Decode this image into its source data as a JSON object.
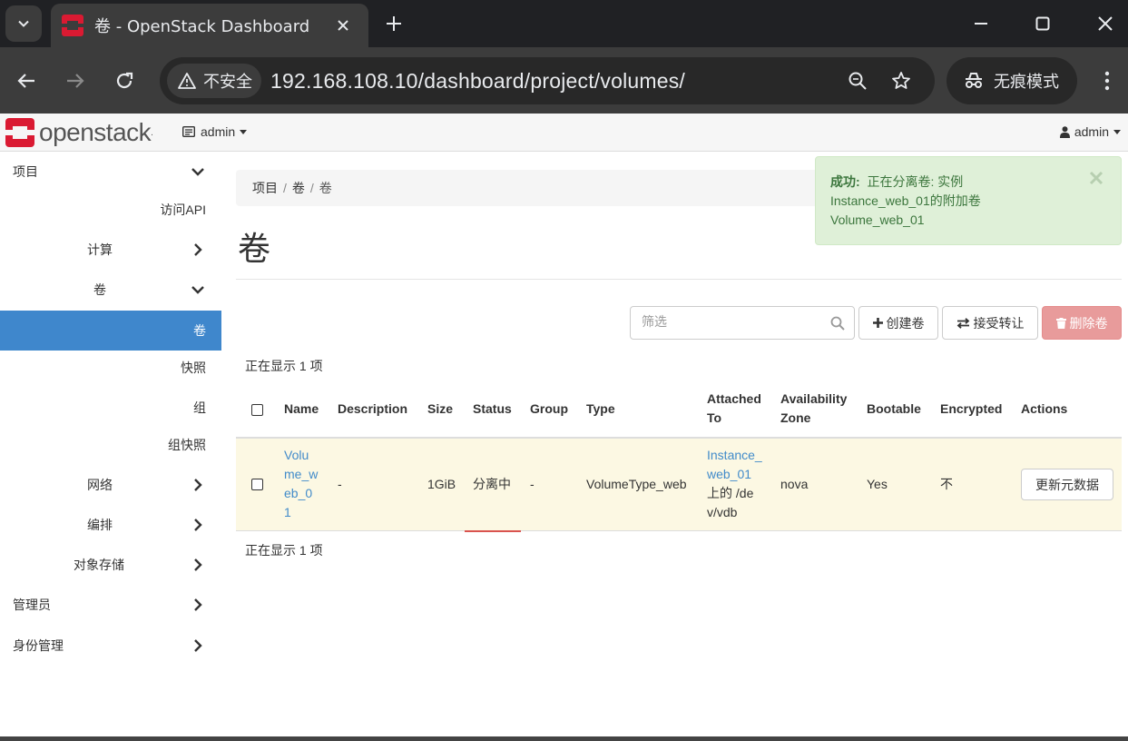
{
  "browser": {
    "tab_title": "卷 - OpenStack Dashboard",
    "security_label": "不安全",
    "url": "192.168.108.10/dashboard/project/volumes/",
    "incognito_label": "无痕模式"
  },
  "header": {
    "logo_text": "openstack",
    "logo_mark": ".",
    "project": "admin",
    "user": "admin"
  },
  "sidebar": {
    "items": [
      {
        "label": "项目"
      },
      {
        "label": "访问API"
      },
      {
        "label": "计算"
      },
      {
        "label": "卷"
      },
      {
        "label": "卷"
      },
      {
        "label": "快照"
      },
      {
        "label": "组"
      },
      {
        "label": "组快照"
      },
      {
        "label": "网络"
      },
      {
        "label": "编排"
      },
      {
        "label": "对象存储"
      },
      {
        "label": "管理员"
      },
      {
        "label": "身份管理"
      }
    ]
  },
  "breadcrumb": [
    "项目",
    "卷",
    "卷"
  ],
  "page_title": "卷",
  "alert": {
    "title": "成功:",
    "line1": "正在分离卷: 实例",
    "line2": "Instance_web_01的附加卷",
    "line3": "Volume_web_01"
  },
  "filter": {
    "placeholder": "筛选"
  },
  "actions": {
    "create": "创建卷",
    "accept_transfer": "接受转让",
    "delete": "删除卷"
  },
  "count_text": "正在显示 1 项",
  "table": {
    "headers": {
      "name": "Name",
      "description": "Description",
      "size": "Size",
      "status": "Status",
      "group": "Group",
      "type": "Type",
      "attached_1": "Attached",
      "attached_2": "To",
      "az_1": "Availability",
      "az_2": "Zone",
      "bootable": "Bootable",
      "encrypted": "Encrypted",
      "actions": "Actions"
    },
    "row": {
      "name_lines": [
        "Volu",
        "me_w",
        "eb_0",
        "1"
      ],
      "description": "-",
      "size": "1GiB",
      "status": "分离中",
      "group": "-",
      "type": "VolumeType_web",
      "attached_link_lines": [
        "Instance_",
        "web_01"
      ],
      "attached_text_lines": [
        "上的 /de",
        "v/vdb"
      ],
      "az": "nova",
      "bootable": "Yes",
      "encrypted": "不",
      "action": "更新元数据"
    }
  },
  "colors": {
    "sidebar_active": "#3f87cc",
    "alert_bg": "#dff0d8",
    "alert_text": "#3c763d",
    "row_highlight": "#fcf8e3",
    "link": "#428bca",
    "danger_button": "#e89b9b",
    "logo_red": "#da1a32"
  }
}
